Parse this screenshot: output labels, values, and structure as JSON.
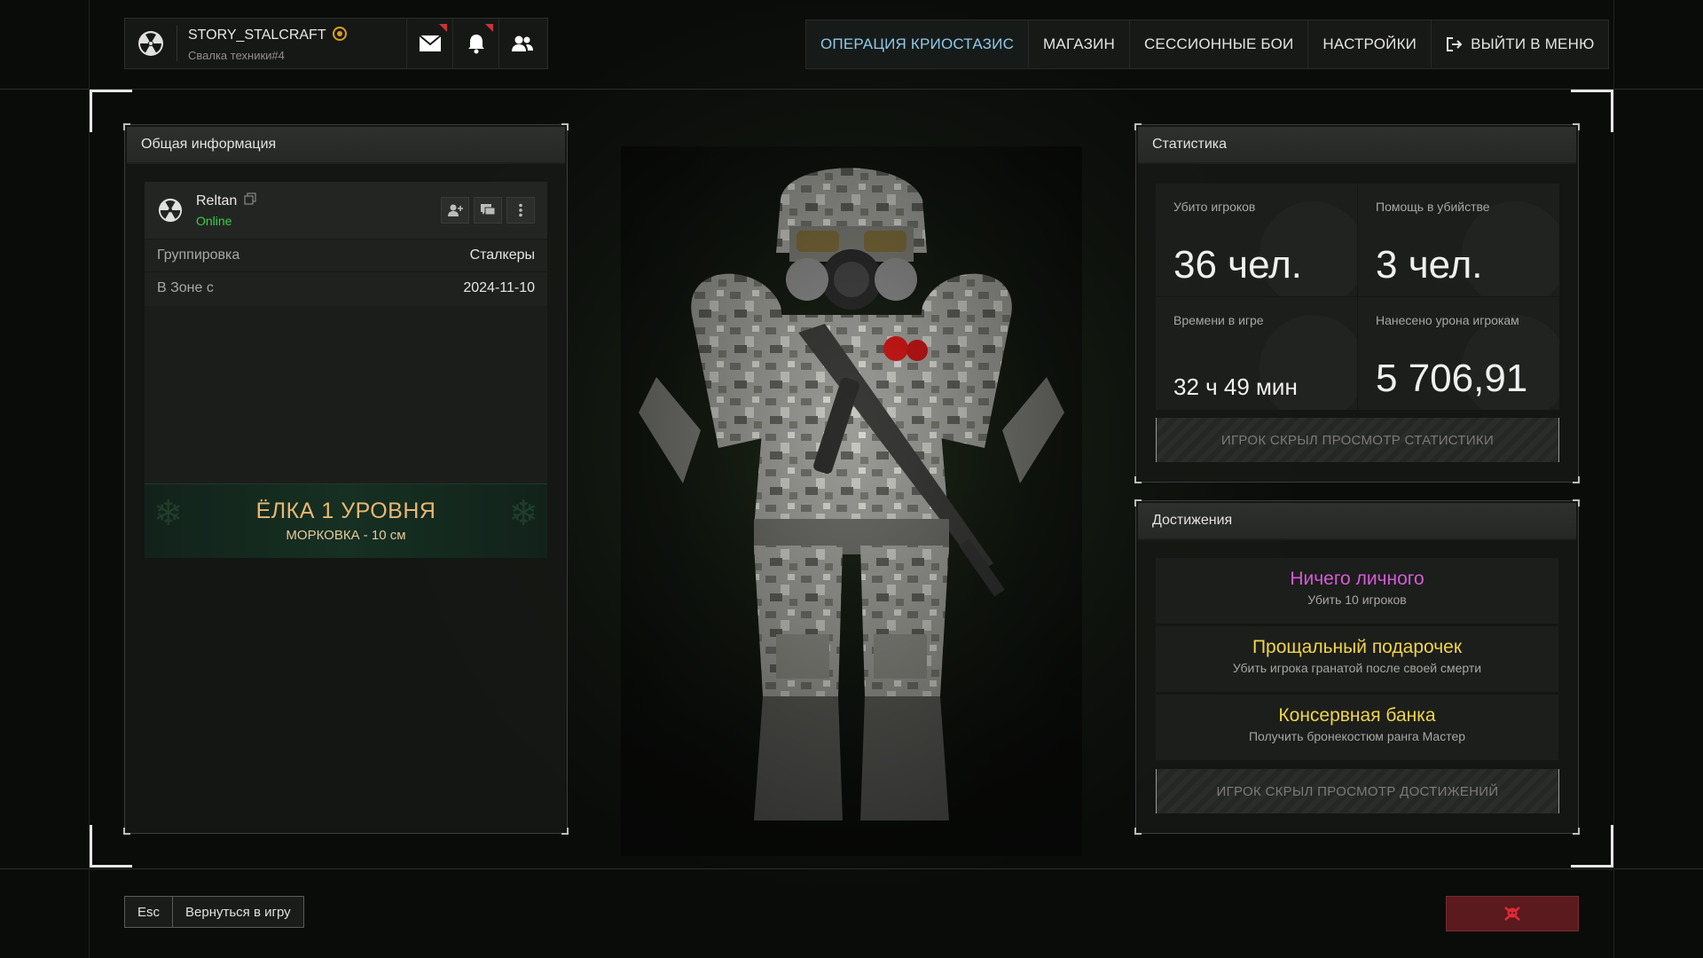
{
  "profile": {
    "username": "STORY_STALCRAFT",
    "server": "Свалка техники#4",
    "icons": [
      "radiation-icon",
      "mail-icon",
      "bell-icon",
      "friends-icon"
    ]
  },
  "nav": {
    "items": [
      {
        "label": "ОПЕРАЦИЯ КРИОСТАЗИС",
        "active": true
      },
      {
        "label": "МАГАЗИН",
        "active": false
      },
      {
        "label": "СЕССИОННЫЕ БОИ",
        "active": false
      },
      {
        "label": "НАСТРОЙКИ",
        "active": false
      },
      {
        "label": "ВЫЙТИ В МЕНЮ",
        "active": false,
        "icon": "exit-icon"
      }
    ]
  },
  "general": {
    "title": "Общая информация",
    "player": {
      "name": "Reltan",
      "status": "Online"
    },
    "rows": [
      {
        "label": "Группировка",
        "value": "Сталкеры"
      },
      {
        "label": "В Зоне с",
        "value": "2024-11-10"
      }
    ],
    "banner": {
      "title": "ЁЛКА 1 УРОВНЯ",
      "subtitle": "МОРКОВКА - 10 см"
    }
  },
  "stats": {
    "title": "Статистика",
    "cells": [
      {
        "label": "Убито игроков",
        "value": "36 чел."
      },
      {
        "label": "Помощь в убийстве",
        "value": "3 чел."
      },
      {
        "label": "Времени в игре",
        "value": "32 ч 49 мин"
      },
      {
        "label": "Нанесено урона игрокам",
        "value": "5 706,91"
      }
    ],
    "hidden_text": "ИГРОК СКРЫЛ ПРОСМОТР СТАТИСТИКИ"
  },
  "achievements": {
    "title": "Достижения",
    "items": [
      {
        "title": "Ничего личного",
        "desc": "Убить 10 игроков",
        "color": "#d65ad8"
      },
      {
        "title": "Прощальный подарочек",
        "desc": "Убить игрока гранатой после своей смерти",
        "color": "#f0d44a"
      },
      {
        "title": "Консервная банка",
        "desc": "Получить бронекостюм ранга Мастер",
        "color": "#f0d44a"
      }
    ],
    "hidden_text": "ИГРОК СКРЫЛ ПРОСМОТР ДОСТИЖЕНИЙ"
  },
  "bottom": {
    "key": "Esc",
    "back_label": "Вернуться в игру"
  },
  "colors": {
    "accent": "#8fc9e6",
    "online": "#35d04a",
    "banner_text": "#e7b873",
    "report": "#5a1a1e"
  }
}
